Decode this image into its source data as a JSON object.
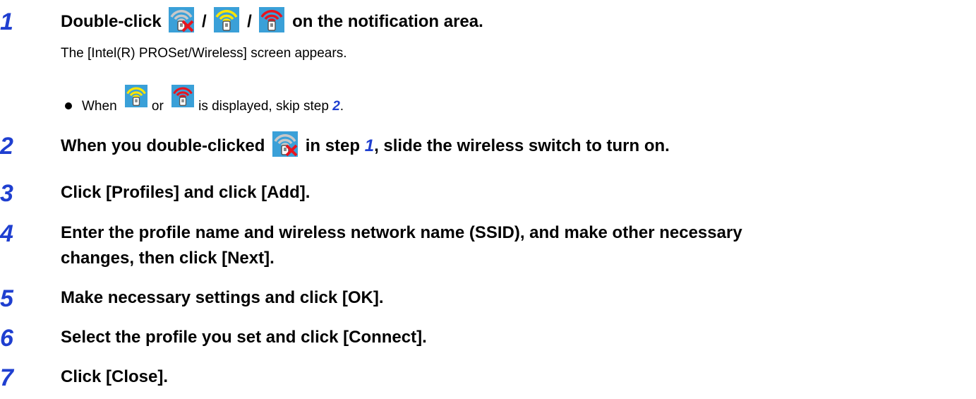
{
  "steps": [
    {
      "number": "1",
      "pre": "Double-click",
      "sep1": "/",
      "sep2": "/",
      "post": "on the notification area.",
      "sub": "The [Intel(R) PROSet/Wireless] screen appears.",
      "bullet": {
        "when": "When",
        "or": "or",
        "rest": "is displayed, skip step",
        "ref": "2",
        "end": "."
      },
      "icons": [
        "wireless-off-icon",
        "wireless-yellow-icon",
        "wireless-red-icon"
      ]
    },
    {
      "number": "2",
      "pre": "When you double-clicked",
      "mid": "in step",
      "ref": "1",
      "post": ", slide the wireless switch to turn on."
    },
    {
      "number": "3",
      "text": "Click [Profiles] and click [Add]."
    },
    {
      "number": "4",
      "line1": "Enter the profile name and wireless network name (SSID), and make other necessary",
      "line2": "changes, then click [Next]."
    },
    {
      "number": "5",
      "text": "Make necessary settings and click [OK]."
    },
    {
      "number": "6",
      "text": "Select the profile you set and click [Connect]."
    },
    {
      "number": "7",
      "text": "Click [Close]."
    }
  ],
  "colors": {
    "step_number": "#1f3fd0",
    "icon_bg": "#3aa0d8",
    "yellow": "#ffe600",
    "red": "#e8141e"
  }
}
